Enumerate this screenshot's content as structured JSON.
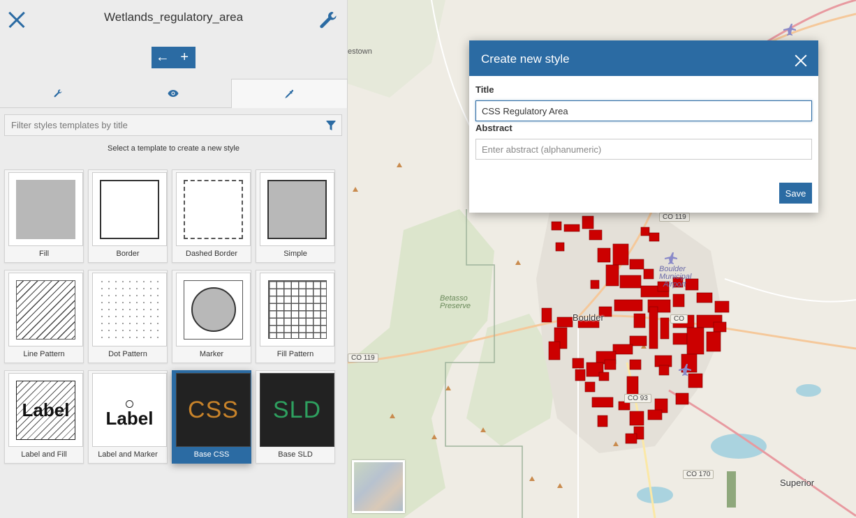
{
  "sidebar": {
    "title": "Wetlands_regulatory_area",
    "toolbar": {
      "back_glyph": "←",
      "add_glyph": "+"
    },
    "tabs": [
      {
        "name": "settings",
        "icon": "wrench-icon"
      },
      {
        "name": "preview",
        "icon": "eye-icon"
      },
      {
        "name": "style",
        "icon": "dropper-icon",
        "active": true
      }
    ],
    "filter_placeholder": "Filter styles templates by title",
    "hint": "Select a template to create a new style",
    "templates": [
      {
        "label": "Fill"
      },
      {
        "label": "Border"
      },
      {
        "label": "Dashed Border"
      },
      {
        "label": "Simple"
      },
      {
        "label": "Line Pattern"
      },
      {
        "label": "Dot Pattern"
      },
      {
        "label": "Marker"
      },
      {
        "label": "Fill Pattern"
      },
      {
        "label": "Label and Fill",
        "thumb_text": "Label"
      },
      {
        "label": "Label and Marker",
        "thumb_text": "Label"
      },
      {
        "label": "Base CSS",
        "thumb_text": "CSS",
        "selected": true
      },
      {
        "label": "Base SLD",
        "thumb_text": "SLD"
      }
    ]
  },
  "dialog": {
    "title": "Create new style",
    "title_label": "Title",
    "title_value": "CSS Regulatory Area",
    "abstract_label": "Abstract",
    "abstract_placeholder": "Enter abstract (alphanumeric)",
    "save_label": "Save"
  },
  "map": {
    "labels": {
      "estown": "estown",
      "betasso": "Betasso",
      "preserve": "Preserve",
      "boulder": "Boulder",
      "airport_1": "Boulder",
      "airport_2": "Municipal",
      "airport_3": "Airport",
      "superior": "Superior"
    },
    "roads": {
      "co119_a": "CO 119",
      "co119_b": "CO 119",
      "co": "CO",
      "co93": "CO 93",
      "co170": "CO 170"
    }
  },
  "colors": {
    "accent": "#2b6ba3",
    "feature": "#cc0000",
    "css_text": "#c8832a",
    "sld_text": "#2ea05f"
  }
}
